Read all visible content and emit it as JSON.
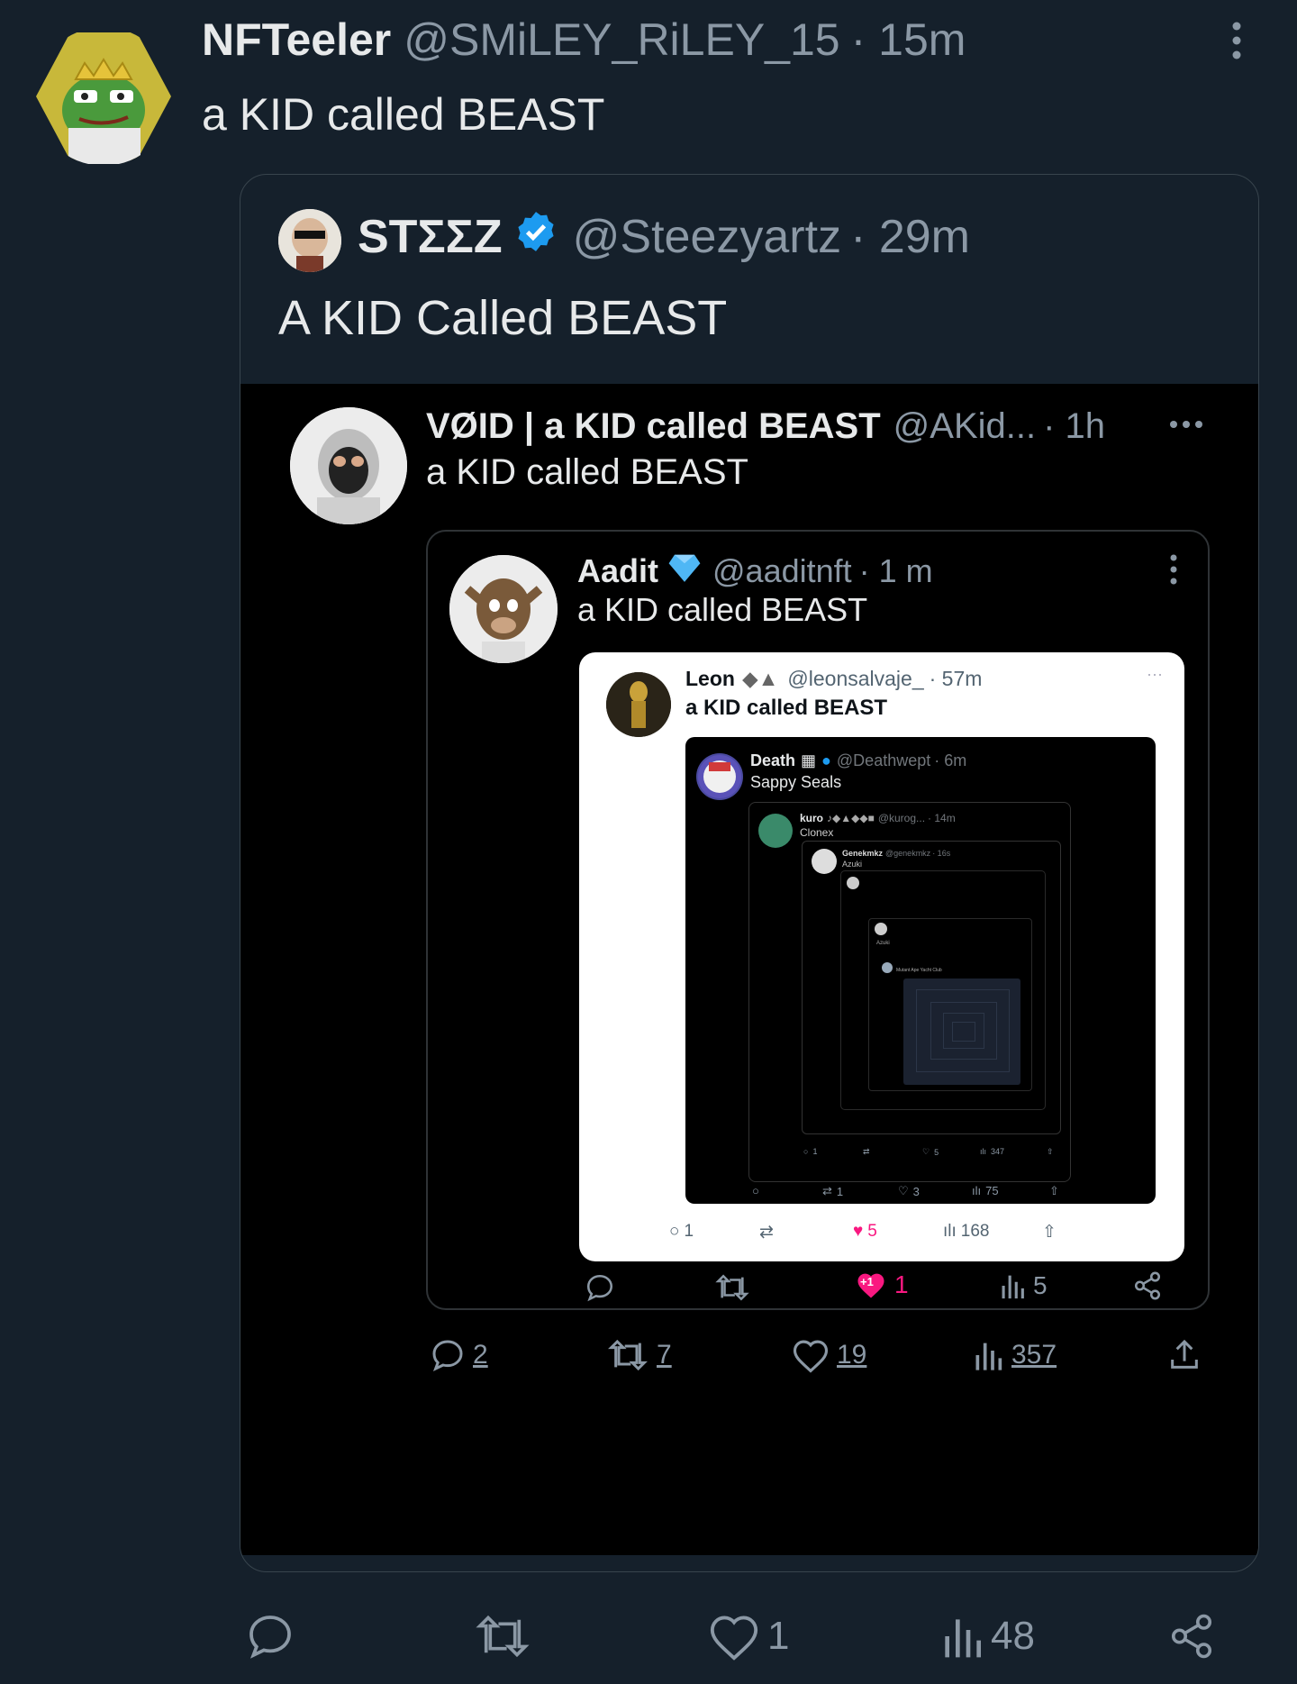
{
  "tweet": {
    "display_name": "NFTeeler",
    "handle": "@SMiLEY_RiLEY_15",
    "time": "· 15m",
    "text": "a KID called BEAST",
    "actions": {
      "replies": "",
      "retweets": "",
      "likes": "1",
      "views": "48"
    }
  },
  "quote": {
    "display_name": "STΣΣZ",
    "handle": "@Steezyartz",
    "time": "· 29m",
    "text": "A KID Called BEAST"
  },
  "screenshot": {
    "void": {
      "display_name": "VØID | a KID called BEAST",
      "handle": "@AKid...",
      "time": "· 1h",
      "text": "a KID called BEAST"
    },
    "aadit": {
      "display_name": "Aadit",
      "handle": "@aaditnft",
      "time": "· 1 m",
      "text": "a KID called BEAST",
      "actions": {
        "likes": "1",
        "like_badge": "+1",
        "views": "5"
      }
    },
    "leon": {
      "display_name": "Leon",
      "handle": "@leonsalvaje_",
      "time": "· 57m",
      "text": "a KID called BEAST",
      "actions": {
        "replies": "1",
        "likes": "5",
        "views": "168"
      }
    },
    "death": {
      "display_name": "Death",
      "handle": "@Deathwept",
      "time": "· 6m",
      "text": "Sappy Seals",
      "actions": {
        "retweets": "1",
        "likes": "3",
        "views": "75"
      }
    },
    "kuro": {
      "display_name": "kuro",
      "handle": "@kurog...",
      "time": "· 14m",
      "text": "Clonex",
      "actions": {
        "replies": "1",
        "likes": "5",
        "views": "347"
      }
    },
    "genek": {
      "display_name": "Genekmkz",
      "handle": "@genekmkz",
      "time": "· 16s",
      "text": "Azuki"
    },
    "deeper_text_1": "Azuki",
    "deeper_text_2": "Mutant Ape Yacht Club",
    "void_actions": {
      "replies": "2",
      "retweets": "7",
      "likes": "19",
      "views": "357"
    }
  },
  "colors": {
    "bg": "#15202b",
    "accent": "#1d9bf0",
    "like": "#f91880",
    "muted": "#8b98a5"
  },
  "icons": [
    "reply-icon",
    "retweet-icon",
    "like-icon",
    "views-icon",
    "share-icon",
    "more-icon",
    "verified-icon",
    "diamond-icon"
  ]
}
